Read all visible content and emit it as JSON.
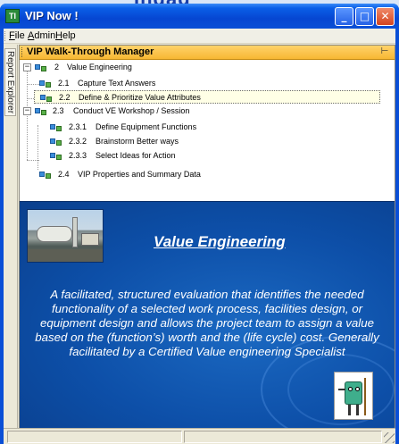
{
  "window": {
    "title": "VIP  Now !",
    "app_icon": "app-icon"
  },
  "banner": {
    "text": "Ingag"
  },
  "menu": {
    "items": [
      "File",
      "Admin",
      "Help"
    ]
  },
  "side_tab": {
    "label": "Report Explorer"
  },
  "pane": {
    "title": "VIP Walk-Through Manager",
    "pin_icon": "pin-icon"
  },
  "tree": {
    "root": {
      "num": "2",
      "text": "Value Engineering"
    },
    "items": [
      {
        "num": "2.1",
        "text": "Capture Text Answers"
      },
      {
        "num": "2.2",
        "text": "Define & Prioritize Value Attributes",
        "selected": true
      },
      {
        "num": "2.3",
        "text": "Conduct VE Workshop / Session"
      },
      {
        "num": "2.3.1",
        "text": "Define Equipment Functions"
      },
      {
        "num": "2.3.2",
        "text": "Brainstorm Better ways"
      },
      {
        "num": "2.3.3",
        "text": "Select Ideas for Action"
      },
      {
        "num": "2.4",
        "text": "VIP Properties and Summary Data"
      }
    ]
  },
  "content": {
    "title": "Value Engineering",
    "description": "A facilitated, structured evaluation that identifies the needed functionality of a selected work process, facilities design, or equipment design and allows the project team to assign a value based on the (function’s) worth and the (life cycle) cost. Generally facilitated by a Certified Value engineering Specialist",
    "colors": {
      "background": "#0d4fa8",
      "text": "#ffffff"
    }
  },
  "colors": {
    "title_bar": "#0a4fd6",
    "pane_header": "#f7b733",
    "selection": "#ffffe6"
  }
}
